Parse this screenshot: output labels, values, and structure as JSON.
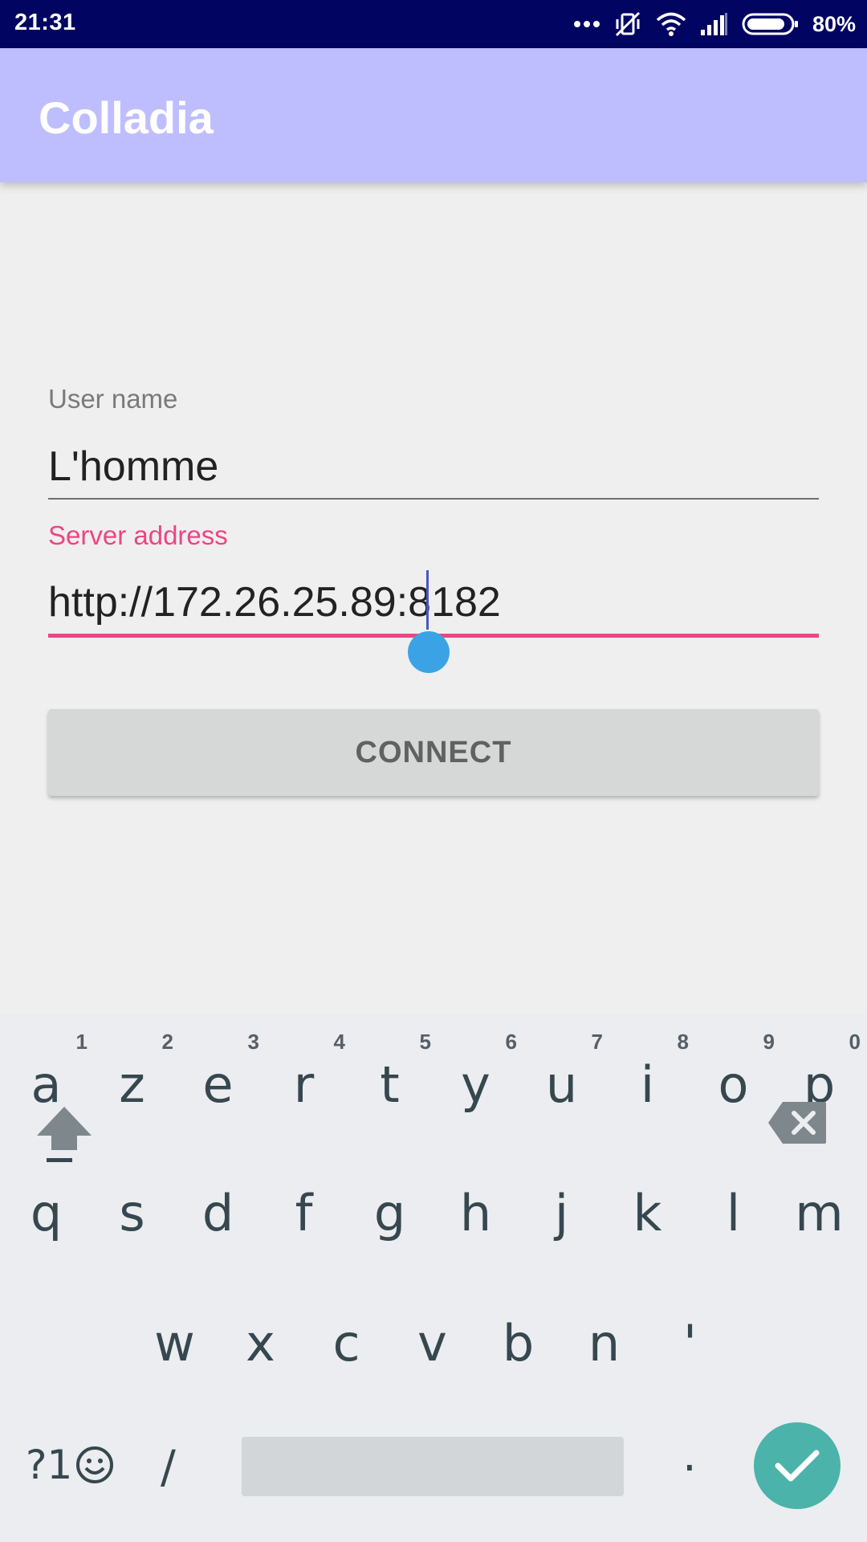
{
  "status_bar": {
    "time": "21:31",
    "battery": "80%",
    "icons": [
      "more-dots-icon",
      "vibrate-off-icon",
      "wifi-icon",
      "signal-icon",
      "battery-icon"
    ]
  },
  "app_bar": {
    "title": "Colladia"
  },
  "form": {
    "user_name": {
      "label": "User name",
      "value": "L'homme"
    },
    "server_address": {
      "label": "Server address",
      "value": "http://172.26.25.89:8182"
    },
    "connect_label": "CONNECT"
  },
  "keyboard": {
    "row1": [
      {
        "char": "a",
        "hint": "1"
      },
      {
        "char": "z",
        "hint": "2"
      },
      {
        "char": "e",
        "hint": "3"
      },
      {
        "char": "r",
        "hint": "4"
      },
      {
        "char": "t",
        "hint": "5"
      },
      {
        "char": "y",
        "hint": "6"
      },
      {
        "char": "u",
        "hint": "7"
      },
      {
        "char": "i",
        "hint": "8"
      },
      {
        "char": "o",
        "hint": "9"
      },
      {
        "char": "p",
        "hint": "0"
      }
    ],
    "row2": [
      "q",
      "s",
      "d",
      "f",
      "g",
      "h",
      "j",
      "k",
      "l",
      "m"
    ],
    "row3": [
      "w",
      "x",
      "c",
      "v",
      "b",
      "n",
      "'"
    ],
    "symbols_label": "?1",
    "slash": "/",
    "period": "."
  },
  "colors": {
    "status_bar": "#020462",
    "app_bar": "#bebeff",
    "accent": "#ee4583",
    "cursor_handle": "#3ba3e5",
    "done_key": "#4bb3aa"
  }
}
